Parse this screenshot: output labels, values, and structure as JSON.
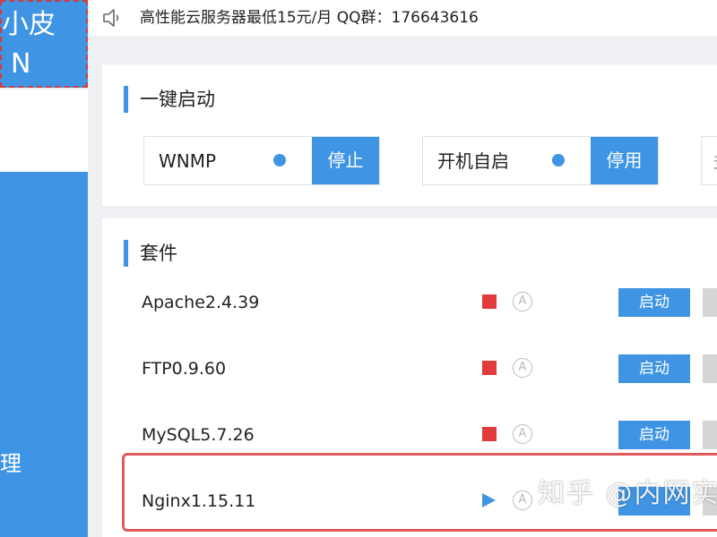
{
  "sidebar": {
    "logo_line1": "小皮",
    "logo_line2": "N",
    "nav_item": "理"
  },
  "notice": {
    "text": "高性能云服务器最低15元/月   QQ群：176643616",
    "icon": "speaker-icon"
  },
  "quick_start": {
    "title": "一键启动",
    "items": [
      {
        "label": "WNMP",
        "status": "running",
        "button": "停止"
      },
      {
        "label": "开机自启",
        "status": "enabled",
        "button": "停用"
      }
    ],
    "partial_item": "多"
  },
  "suite": {
    "title": "套件",
    "rows": [
      {
        "name": "Apache2.4.39",
        "status": "stopped",
        "button": "启动"
      },
      {
        "name": "FTP0.9.60",
        "status": "stopped",
        "button": "启动"
      },
      {
        "name": "MySQL5.7.26",
        "status": "stopped",
        "button": "启动"
      },
      {
        "name": "Nginx1.15.11",
        "status": "running",
        "button": ""
      }
    ],
    "auto_icon_glyph": "A"
  },
  "watermark": "知乎 @内网实",
  "colors": {
    "accent": "#3f95e4",
    "stopped": "#e23b3b",
    "highlight": "#e05a5a"
  }
}
